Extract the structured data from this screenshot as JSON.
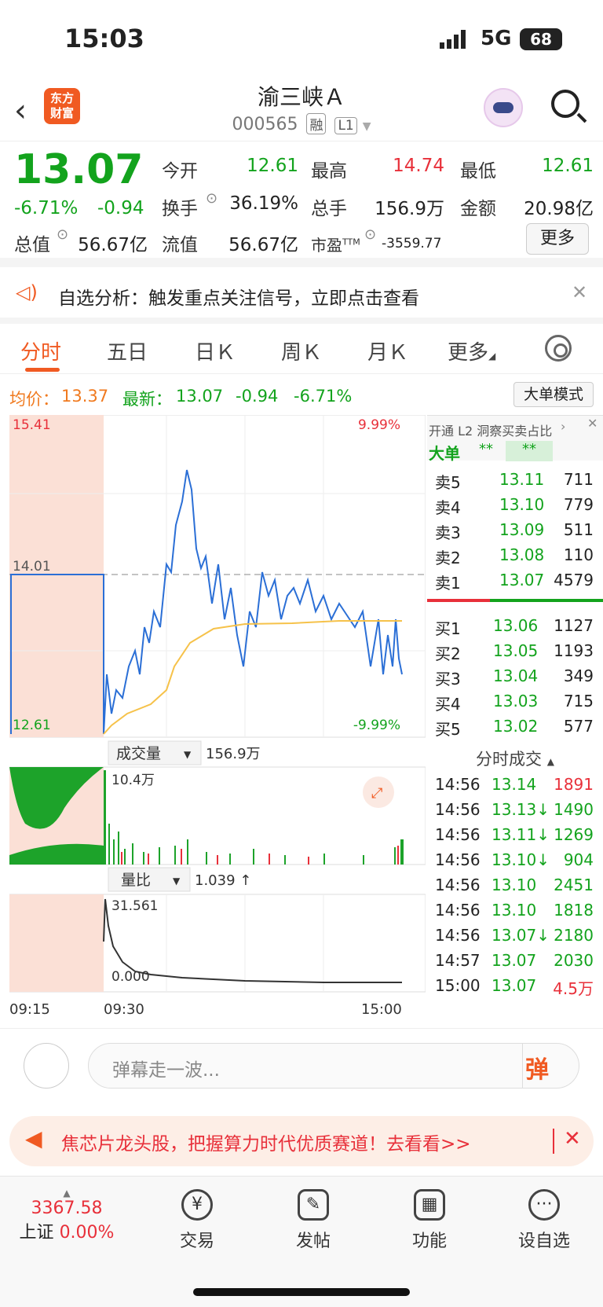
{
  "status": {
    "time": "15:03",
    "network": "5G",
    "battery": "68"
  },
  "nav": {
    "title": "渝三峡Ａ",
    "code": "000565",
    "tag1": "融",
    "tag2": "L1",
    "logo_line1": "东方",
    "logo_line2": "财富"
  },
  "quote": {
    "price": "13.07",
    "change_pct": "-6.71%",
    "change": "-0.94",
    "fields": [
      {
        "label": "今开",
        "value": "12.61"
      },
      {
        "label": "最高",
        "value": "14.74"
      },
      {
        "label": "最低",
        "value": "12.61"
      },
      {
        "label": "换手",
        "value": "36.19%"
      },
      {
        "label": "总手",
        "value": "156.9万"
      },
      {
        "label": "金额",
        "value": "20.98亿"
      },
      {
        "label": "总值",
        "value": "56.67亿"
      },
      {
        "label": "流值",
        "value": "56.67亿"
      },
      {
        "label": "市盈",
        "sup": "TTM",
        "value": "-3559.77"
      }
    ],
    "more": "更多"
  },
  "banner": {
    "text": "自选分析：触发重点关注信号，立即点击查看"
  },
  "tabs": [
    "分时",
    "五日",
    "日Ｋ",
    "周Ｋ",
    "月Ｋ",
    "更多"
  ],
  "avg": {
    "avg_label": "均价：",
    "avg": "13.37",
    "latest_label": "最新：",
    "latest": "13.07",
    "chg": "-0.94",
    "pct": "-6.71%",
    "mode_button": "大单模式"
  },
  "chart": {
    "y_top": "15.41",
    "y_mid": "14.01",
    "y_bottom": "12.61",
    "pct_top": "9.99%",
    "pct_bottom": "-9.99%",
    "volume_label": "成交量",
    "volume_total": "156.9万",
    "volume_max": "10.4万",
    "ratio_label": "量比",
    "ratio_value": "1.039 ↑",
    "ratio_max": "31.561",
    "ratio_min": "0.000",
    "time_start": "09:15",
    "time_open": "09:30",
    "time_end": "15:00"
  },
  "side": {
    "l2_text": "开通 L2 洞察买卖占比",
    "big_label": "大单",
    "big_v1": "**",
    "big_v2": "**",
    "sells": [
      {
        "label": "卖5",
        "price": "13.11",
        "vol": "711"
      },
      {
        "label": "卖4",
        "price": "13.10",
        "vol": "779"
      },
      {
        "label": "卖3",
        "price": "13.09",
        "vol": "511"
      },
      {
        "label": "卖2",
        "price": "13.08",
        "vol": "110"
      },
      {
        "label": "卖1",
        "price": "13.07",
        "vol": "4579"
      }
    ],
    "buys": [
      {
        "label": "买1",
        "price": "13.06",
        "vol": "1127"
      },
      {
        "label": "买2",
        "price": "13.05",
        "vol": "1193"
      },
      {
        "label": "买3",
        "price": "13.04",
        "vol": "349"
      },
      {
        "label": "买4",
        "price": "13.03",
        "vol": "715"
      },
      {
        "label": "买5",
        "price": "13.02",
        "vol": "577"
      }
    ],
    "trades_title": "分时成交",
    "trades": [
      {
        "time": "14:56",
        "price": "13.14",
        "vol": "1891",
        "color": "red"
      },
      {
        "time": "14:56",
        "price": "13.13↓",
        "vol": "1490",
        "color": "green"
      },
      {
        "time": "14:56",
        "price": "13.11↓",
        "vol": "1269",
        "color": "green"
      },
      {
        "time": "14:56",
        "price": "13.10↓",
        "vol": "904",
        "color": "green"
      },
      {
        "time": "14:56",
        "price": "13.10",
        "vol": "2451",
        "color": "green"
      },
      {
        "time": "14:56",
        "price": "13.10",
        "vol": "1818",
        "color": "green"
      },
      {
        "time": "14:56",
        "price": "13.07↓",
        "vol": "2180",
        "color": "green"
      },
      {
        "time": "14:57",
        "price": "13.07",
        "vol": "2030",
        "color": "green"
      },
      {
        "time": "15:00",
        "price": "13.07",
        "vol": "4.5万",
        "color": "red"
      }
    ]
  },
  "comment": {
    "placeholder": "弹幕走一波...",
    "send": "弹"
  },
  "promo": {
    "text": "焦芯片龙头股，把握算力时代优质赛道！去看看>>"
  },
  "tabbar": {
    "index_value": "3367.58",
    "index_name": "上证",
    "index_pct": "0.00%",
    "items": [
      {
        "label": "交易",
        "icon": "¥"
      },
      {
        "label": "发帖",
        "icon": "✎"
      },
      {
        "label": "功能",
        "icon": "▦"
      },
      {
        "label": "设自选",
        "icon": "···"
      }
    ]
  }
}
